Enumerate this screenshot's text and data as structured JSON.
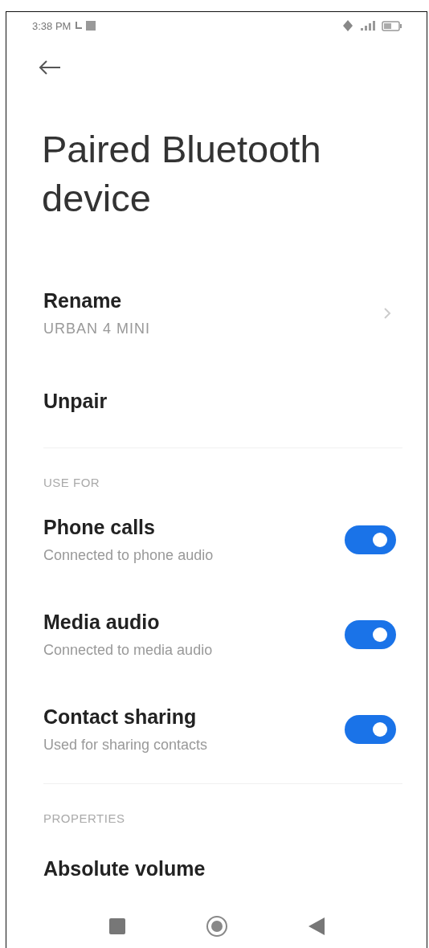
{
  "status_bar": {
    "time": "3:38 PM"
  },
  "title": "Paired Bluetooth device",
  "items": [
    {
      "kind": "link",
      "title": "Rename",
      "subtitle": "URBAN 4 MINI"
    },
    {
      "kind": "action",
      "title": "Unpair"
    }
  ],
  "sections": [
    {
      "header": "USE FOR",
      "items": [
        {
          "kind": "toggle",
          "title": "Phone calls",
          "subtitle": "Connected to phone audio",
          "on": true
        },
        {
          "kind": "toggle",
          "title": "Media audio",
          "subtitle": "Connected to media audio",
          "on": true
        },
        {
          "kind": "toggle",
          "title": "Contact sharing",
          "subtitle": "Used for sharing contacts",
          "on": true
        }
      ]
    },
    {
      "header": "PROPERTIES",
      "items": [
        {
          "kind": "action",
          "title": "Absolute volume"
        }
      ]
    }
  ]
}
